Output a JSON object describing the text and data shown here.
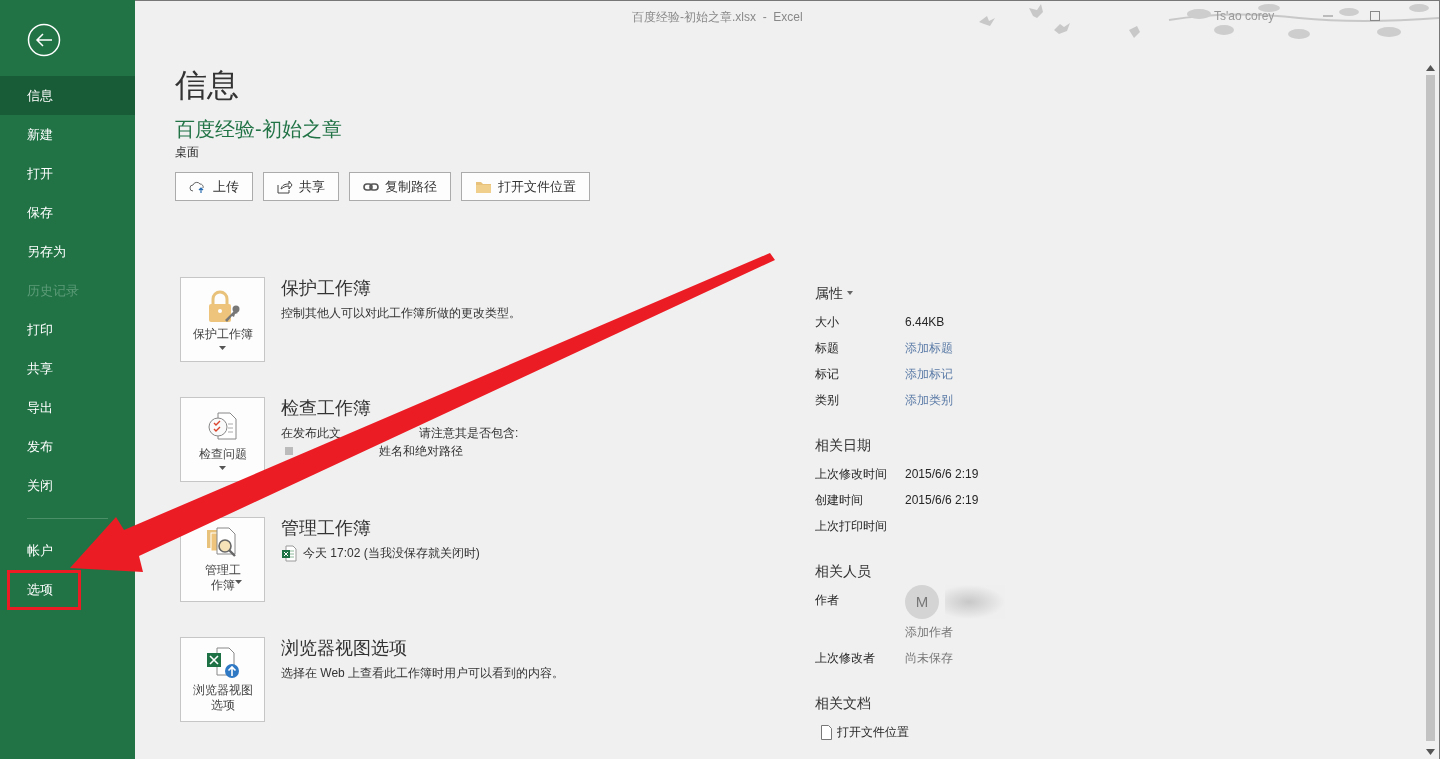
{
  "window": {
    "title": "百度经验-初始之章.xlsx  -  Excel",
    "user": "Ts'ao corey"
  },
  "sidebar": {
    "items": [
      {
        "label": "信息",
        "selected": true,
        "disabled": false,
        "highlighted": false
      },
      {
        "label": "新建",
        "selected": false,
        "disabled": false,
        "highlighted": false
      },
      {
        "label": "打开",
        "selected": false,
        "disabled": false,
        "highlighted": false
      },
      {
        "label": "保存",
        "selected": false,
        "disabled": false,
        "highlighted": false
      },
      {
        "label": "另存为",
        "selected": false,
        "disabled": false,
        "highlighted": false
      },
      {
        "label": "历史记录",
        "selected": false,
        "disabled": true,
        "highlighted": false
      },
      {
        "label": "打印",
        "selected": false,
        "disabled": false,
        "highlighted": false
      },
      {
        "label": "共享",
        "selected": false,
        "disabled": false,
        "highlighted": false
      },
      {
        "label": "导出",
        "selected": false,
        "disabled": false,
        "highlighted": false
      },
      {
        "label": "发布",
        "selected": false,
        "disabled": false,
        "highlighted": false
      },
      {
        "label": "关闭",
        "selected": false,
        "disabled": false,
        "highlighted": false
      }
    ],
    "footer_items": [
      {
        "label": "帐户",
        "selected": false,
        "disabled": false,
        "highlighted": false
      },
      {
        "label": "选项",
        "selected": false,
        "disabled": false,
        "highlighted": true
      }
    ]
  },
  "page": {
    "title": "信息",
    "file_name": "百度经验-初始之章",
    "location": "桌面",
    "actions": [
      {
        "kind": "upload",
        "label": "上传"
      },
      {
        "kind": "share",
        "label": "共享"
      },
      {
        "kind": "link",
        "label": "复制路径"
      },
      {
        "kind": "folder",
        "label": "打开文件位置"
      }
    ]
  },
  "sections": [
    {
      "kind": "protect",
      "button_label": "保护工作簿",
      "dropdown": true,
      "title": "保护工作簿",
      "lines": [
        {
          "kind": "text",
          "parts": [
            "控制其他人可以对此工作簿所做的更改类型。"
          ]
        }
      ]
    },
    {
      "kind": "inspect",
      "button_label": "检查问题",
      "dropdown": true,
      "title": "检查工作簿",
      "lines": [
        {
          "kind": "text",
          "parts": [
            "在发布此文",
            "请注意其是否包含:"
          ]
        },
        {
          "kind": "bullet",
          "parts": [
            "姓名和绝对路径"
          ]
        }
      ]
    },
    {
      "kind": "manage",
      "button_label": "管理工作簿",
      "dropdown": true,
      "title": "管理工作簿",
      "lines": [
        {
          "kind": "file",
          "parts": [
            "今天 17:02 (当我没保存就关闭时)"
          ]
        }
      ]
    },
    {
      "kind": "browser",
      "button_label": "浏览器视图选项",
      "dropdown": false,
      "title": "浏览器视图选项",
      "lines": [
        {
          "kind": "text",
          "parts": [
            "选择在 Web 上查看此工作簿时用户可以看到的内容。"
          ]
        }
      ]
    }
  ],
  "properties": [
    {
      "heading": "属性",
      "dropdown": true,
      "rows": [
        {
          "kind": "value",
          "label": "大小",
          "value": "6.44KB"
        },
        {
          "kind": "link",
          "label": "标题",
          "value": "添加标题"
        },
        {
          "kind": "link",
          "label": "标记",
          "value": "添加标记"
        },
        {
          "kind": "link",
          "label": "类别",
          "value": "添加类别"
        }
      ]
    },
    {
      "heading": "相关日期",
      "dropdown": false,
      "rows": [
        {
          "kind": "value",
          "label": "上次修改时间",
          "value": "2015/6/6 2:19"
        },
        {
          "kind": "value",
          "label": "创建时间",
          "value": "2015/6/6 2:19"
        },
        {
          "kind": "value",
          "label": "上次打印时间"
        }
      ]
    },
    {
      "heading": "相关人员",
      "dropdown": false,
      "rows": [
        {
          "kind": "person",
          "label": "作者",
          "initial": "M",
          "value": "添加作者"
        },
        {
          "kind": "muted",
          "label": "上次修改者",
          "value": "尚未保存"
        }
      ]
    },
    {
      "heading": "相关文档",
      "dropdown": false,
      "rows": [
        {
          "kind": "file",
          "value": "打开文件位置"
        }
      ]
    }
  ],
  "annotation": {
    "arrow": true
  }
}
